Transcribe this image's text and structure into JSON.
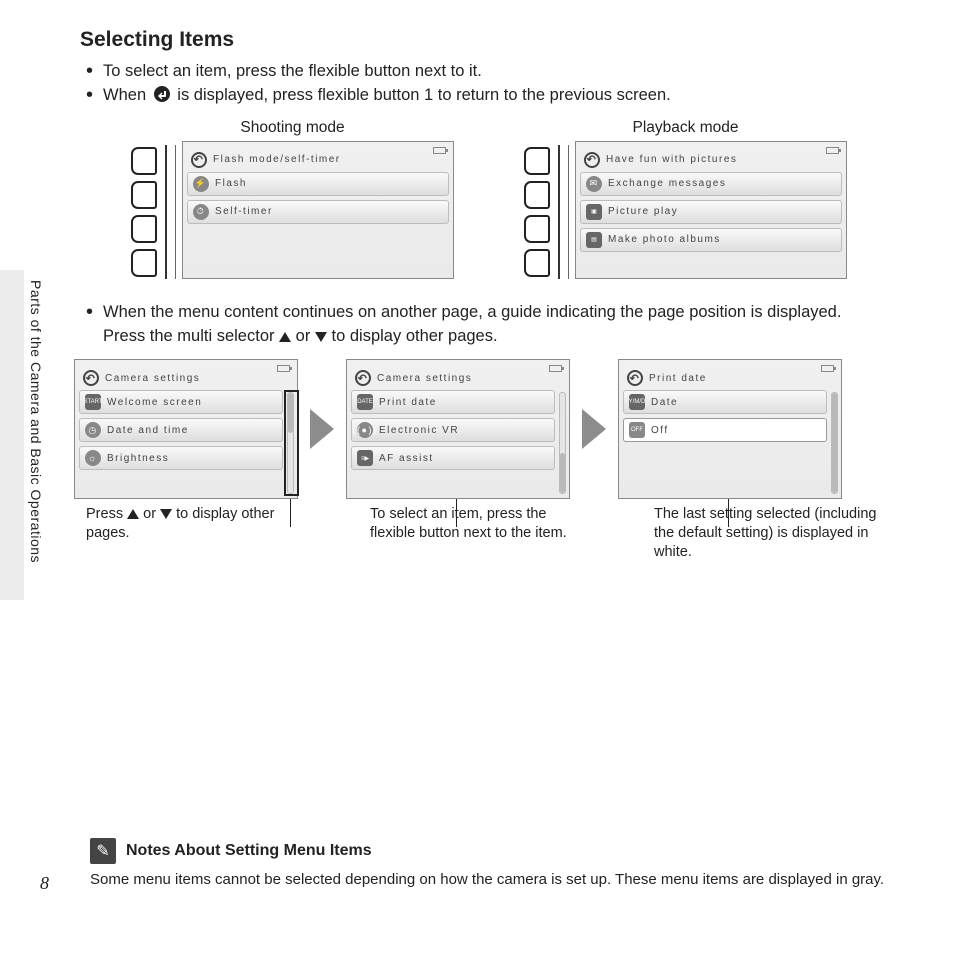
{
  "title": "Selecting Items",
  "side_label": "Parts of the Camera and Basic Operations",
  "page_number": "8",
  "bullets": {
    "b1": "To select an item, press the flexible button next to it.",
    "b2_a": "When ",
    "b2_b": " is displayed, press flexible button 1 to return to the previous screen."
  },
  "top_screens": {
    "shooting": {
      "label": "Shooting mode",
      "header": "Flash mode/self-timer",
      "rows": [
        "Flash",
        "Self-timer"
      ]
    },
    "playback": {
      "label": "Playback mode",
      "header": "Have fun with pictures",
      "rows": [
        "Exchange messages",
        "Picture play",
        "Make photo albums"
      ]
    }
  },
  "mid_bullet": {
    "line1": "When the menu content continues on another page, a guide indicating the page position is displayed.",
    "line2_a": "Press the multi selector ",
    "line2_mid": " or ",
    "line2_b": " to display other pages."
  },
  "settings_screens": {
    "s1": {
      "header": "Camera settings",
      "rows": [
        "Welcome screen",
        "Date and time",
        "Brightness"
      ]
    },
    "s2": {
      "header": "Camera settings",
      "rows": [
        "Print date",
        "Electronic VR",
        "AF assist"
      ]
    },
    "s3": {
      "header": "Print date",
      "rows": [
        "Date",
        "Off"
      ]
    }
  },
  "captions": {
    "c1_a": "Press ",
    "c1_mid": " or ",
    "c1_b": " to display other pages.",
    "c2": "To select an item, press the flexible button next to the item.",
    "c3": "The last setting selected (including the default setting) is displayed in white."
  },
  "notes": {
    "title": "Notes About Setting Menu Items",
    "body": "Some menu items cannot be selected depending on how the camera is set up. These menu items are displayed in gray."
  },
  "icon_labels": {
    "start": "START",
    "date": "DATE",
    "ymd": "Y/M/D",
    "off": "OFF"
  }
}
